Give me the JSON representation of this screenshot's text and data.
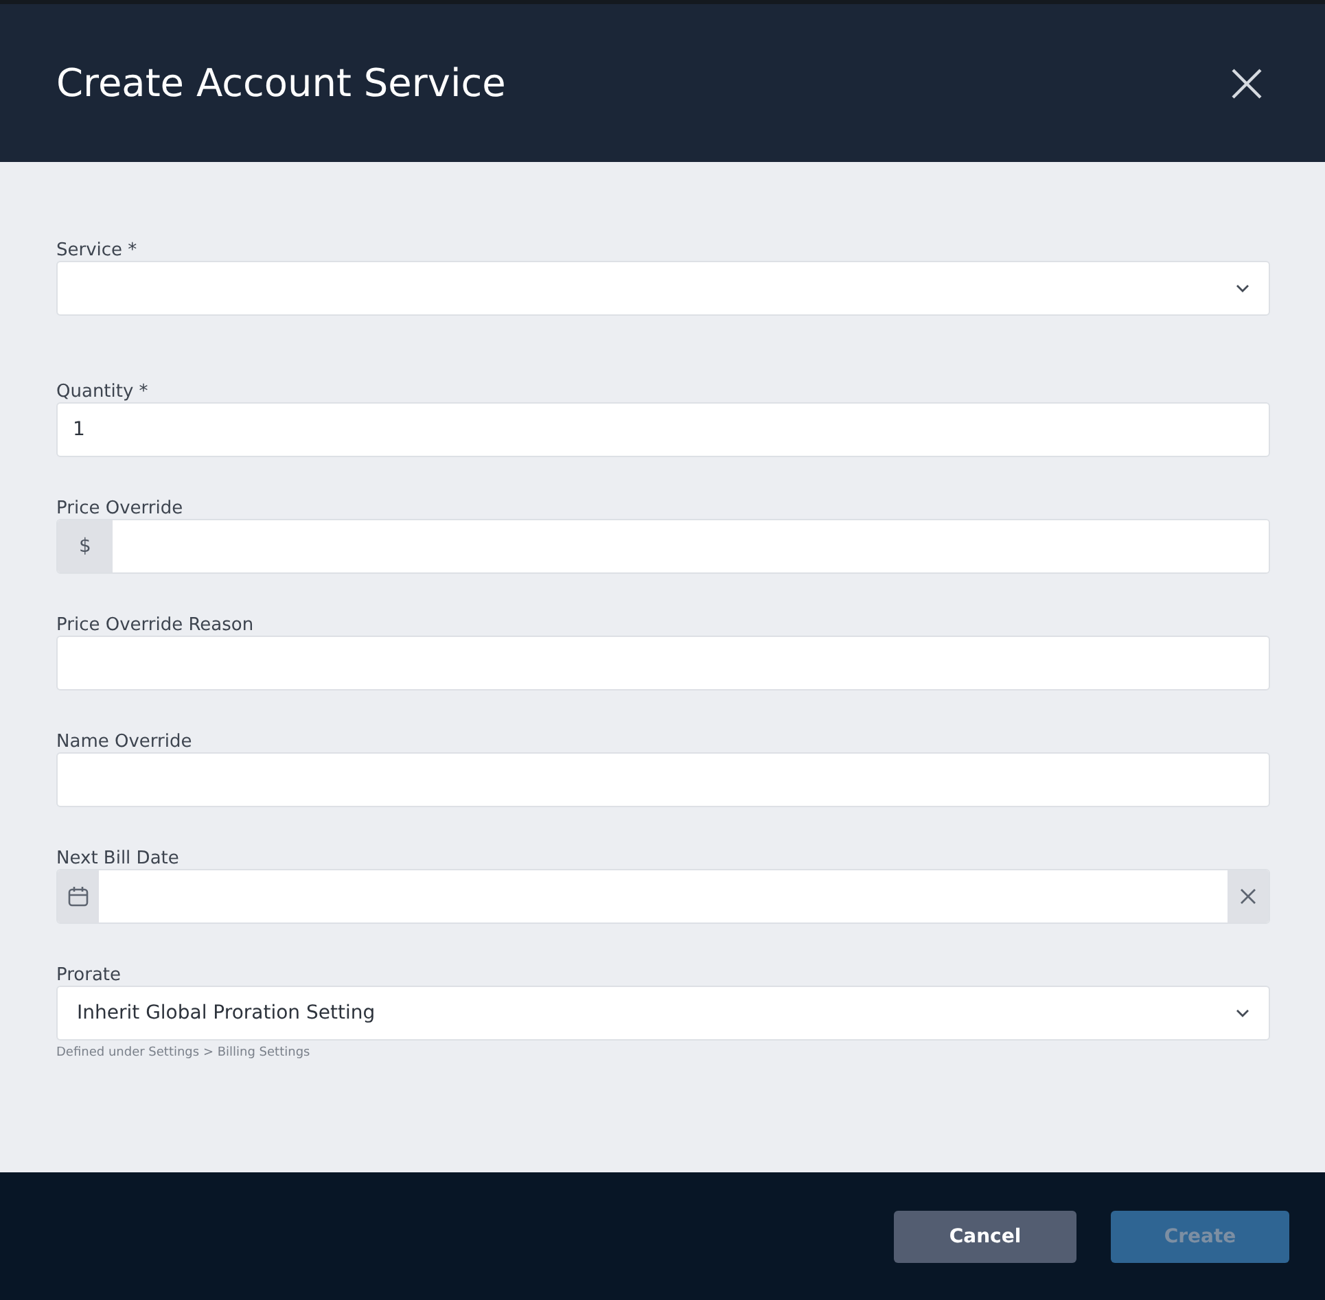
{
  "dialog": {
    "title": "Create Account Service"
  },
  "fields": [
    {
      "kind": "select",
      "label": "Service *"
    },
    {
      "kind": "text",
      "label": "Quantity *",
      "value": "1"
    },
    {
      "kind": "prefix",
      "label": "Price Override",
      "prefix": "$"
    },
    {
      "kind": "text",
      "label": "Price Override Reason"
    },
    {
      "kind": "text",
      "label": "Name Override"
    },
    {
      "kind": "date",
      "label": "Next Bill Date"
    },
    {
      "kind": "select",
      "label": "Prorate",
      "value": "Inherit Global Proration Setting",
      "hint": "Defined under Settings > Billing Settings"
    }
  ],
  "buttons": [
    {
      "kind": "cancel",
      "label": "Cancel",
      "disabled": false
    },
    {
      "kind": "primary",
      "label": "Create",
      "disabled": true
    }
  ]
}
